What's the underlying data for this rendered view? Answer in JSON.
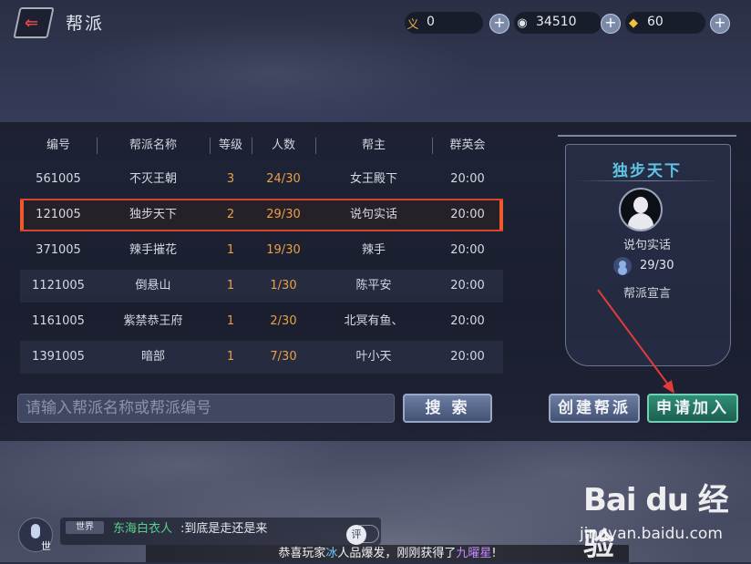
{
  "header": {
    "title": "帮派",
    "back_icon": "back-arrow-icon"
  },
  "resources": [
    {
      "name": "righteousness",
      "icon_glyph": "义",
      "value": "0"
    },
    {
      "name": "silver",
      "icon_glyph": "◉",
      "value": "34510"
    },
    {
      "name": "gold-ingot",
      "icon_glyph": "◆",
      "value": "60"
    }
  ],
  "plus_label": "+",
  "table": {
    "headers": [
      "编号",
      "帮派名称",
      "等级",
      "人数",
      "帮主",
      "群英会"
    ],
    "rows": [
      {
        "id": "561005",
        "name": "不灭王朝",
        "level": "3",
        "members": "24/30",
        "leader": "女王殿下",
        "time": "20:00"
      },
      {
        "id": "121005",
        "name": "独步天下",
        "level": "2",
        "members": "29/30",
        "leader": "说句实话",
        "time": "20:00",
        "selected": true
      },
      {
        "id": "371005",
        "name": "辣手摧花",
        "level": "1",
        "members": "19/30",
        "leader": "辣手",
        "time": "20:00"
      },
      {
        "id": "1121005",
        "name": "倒悬山",
        "level": "1",
        "members": "1/30",
        "leader": "陈平安",
        "time": "20:00"
      },
      {
        "id": "1161005",
        "name": "紫禁恭王府",
        "level": "1",
        "members": "2/30",
        "leader": "北冥有鱼、",
        "time": "20:00"
      },
      {
        "id": "1391005",
        "name": "暗部",
        "level": "1",
        "members": "7/30",
        "leader": "叶小天",
        "time": "20:00"
      }
    ]
  },
  "detail": {
    "guild_name": "独步天下",
    "leader": "说句实话",
    "members": "29/30",
    "declaration_label": "帮派宣言"
  },
  "search": {
    "placeholder": "请输入帮派名称或帮派编号",
    "button": "搜 索"
  },
  "actions": {
    "create": "创建帮派",
    "apply": "申请加入"
  },
  "chat": {
    "channel_short": "世",
    "tag": "世界",
    "sender": "东海白衣人",
    "message": ":到底是走还是来",
    "reply_label": "评"
  },
  "ticker": {
    "prefix": "恭喜玩家",
    "player": "冰",
    "middle": "人品爆发，刚刚获得了",
    "item": "九曜星",
    "suffix": "!"
  },
  "watermark": {
    "logo": "Bai du 经验",
    "url": "jingyan.baidu.com"
  },
  "colors": {
    "highlight": "#d3452f",
    "accent_title": "#5fc4e4",
    "level_orange": "#e8a04a",
    "apply_green": "#2f8f77"
  }
}
